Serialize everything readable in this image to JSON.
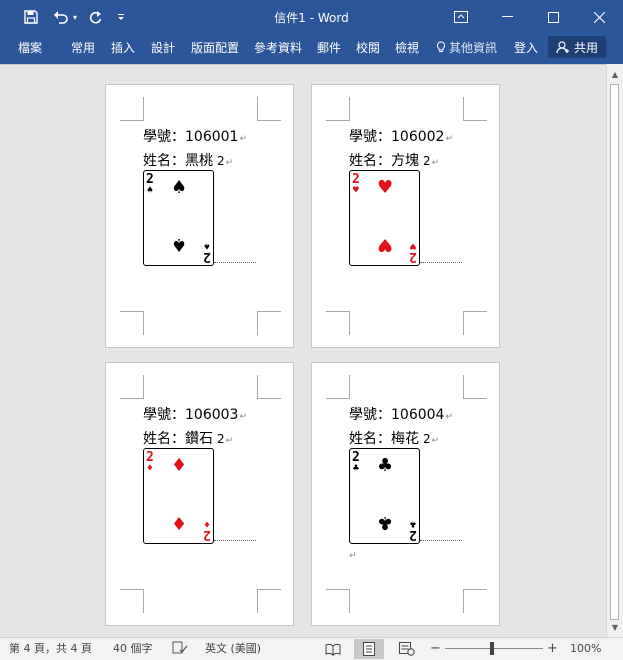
{
  "window": {
    "title": "信件1 - Word",
    "brand_color": "#2b579a"
  },
  "quick_access": {
    "save_icon": "save-icon",
    "undo_icon": "undo-icon",
    "undo_dropdown_icon": "chevron-down-icon",
    "redo_icon": "redo-icon",
    "customize_icon": "customize-icon"
  },
  "window_controls": {
    "ribbon_display": "ribbon-display-icon",
    "minimize": "minimize-icon",
    "maximize": "maximize-icon",
    "close": "close-icon"
  },
  "ribbon": {
    "file": "檔案",
    "tabs": [
      "常用",
      "插入",
      "設計",
      "版面配置",
      "參考資料",
      "郵件",
      "校閱",
      "檢視"
    ],
    "tell_me": "其他資訊",
    "sign_in": "登入",
    "share": "共用"
  },
  "pages": [
    {
      "id": "106001",
      "id_label": "學號：106001",
      "name_label": "姓名：",
      "name": "黑桃",
      "number": "2",
      "rank": "2",
      "suit": "♠",
      "suit_name": "spade",
      "color": "#000000"
    },
    {
      "id": "106002",
      "id_label": "學號：106002",
      "name_label": "姓名：",
      "name": "方塊",
      "number": "2",
      "rank": "2",
      "suit": "♥",
      "suit_name": "heart",
      "color": "#e3111c"
    },
    {
      "id": "106003",
      "id_label": "學號：106003",
      "name_label": "姓名：",
      "name": "鑽石",
      "number": "2",
      "rank": "2",
      "suit": "♦",
      "suit_name": "diamond",
      "color": "#e3111c"
    },
    {
      "id": "106004",
      "id_label": "學號：106004",
      "name_label": "姓名：",
      "name": "梅花",
      "number": "2",
      "rank": "2",
      "suit": "♣",
      "suit_name": "club",
      "color": "#000000"
    }
  ],
  "paragraph_mark": "↵",
  "status": {
    "page_info": "第 4 頁，共 4 頁",
    "word_count": "40 個字",
    "language": "英文 (美國)",
    "zoom": "100%",
    "zoom_out": "−",
    "zoom_in": "+"
  }
}
